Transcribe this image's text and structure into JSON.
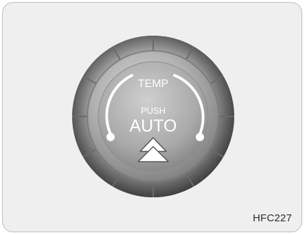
{
  "knob": {
    "top_label": "TEMP",
    "push_label": "PUSH",
    "main_label": "AUTO"
  },
  "caption": {
    "figure_code": "HFC227"
  },
  "colors": {
    "background": "#efefef",
    "outer_ring": "#8f8f8f",
    "inner_cap": "#b8b8b8",
    "arc_white": "#ffffff"
  },
  "icons": [
    "up-arrow-triangle-icon",
    "temp-arc-indicator"
  ]
}
